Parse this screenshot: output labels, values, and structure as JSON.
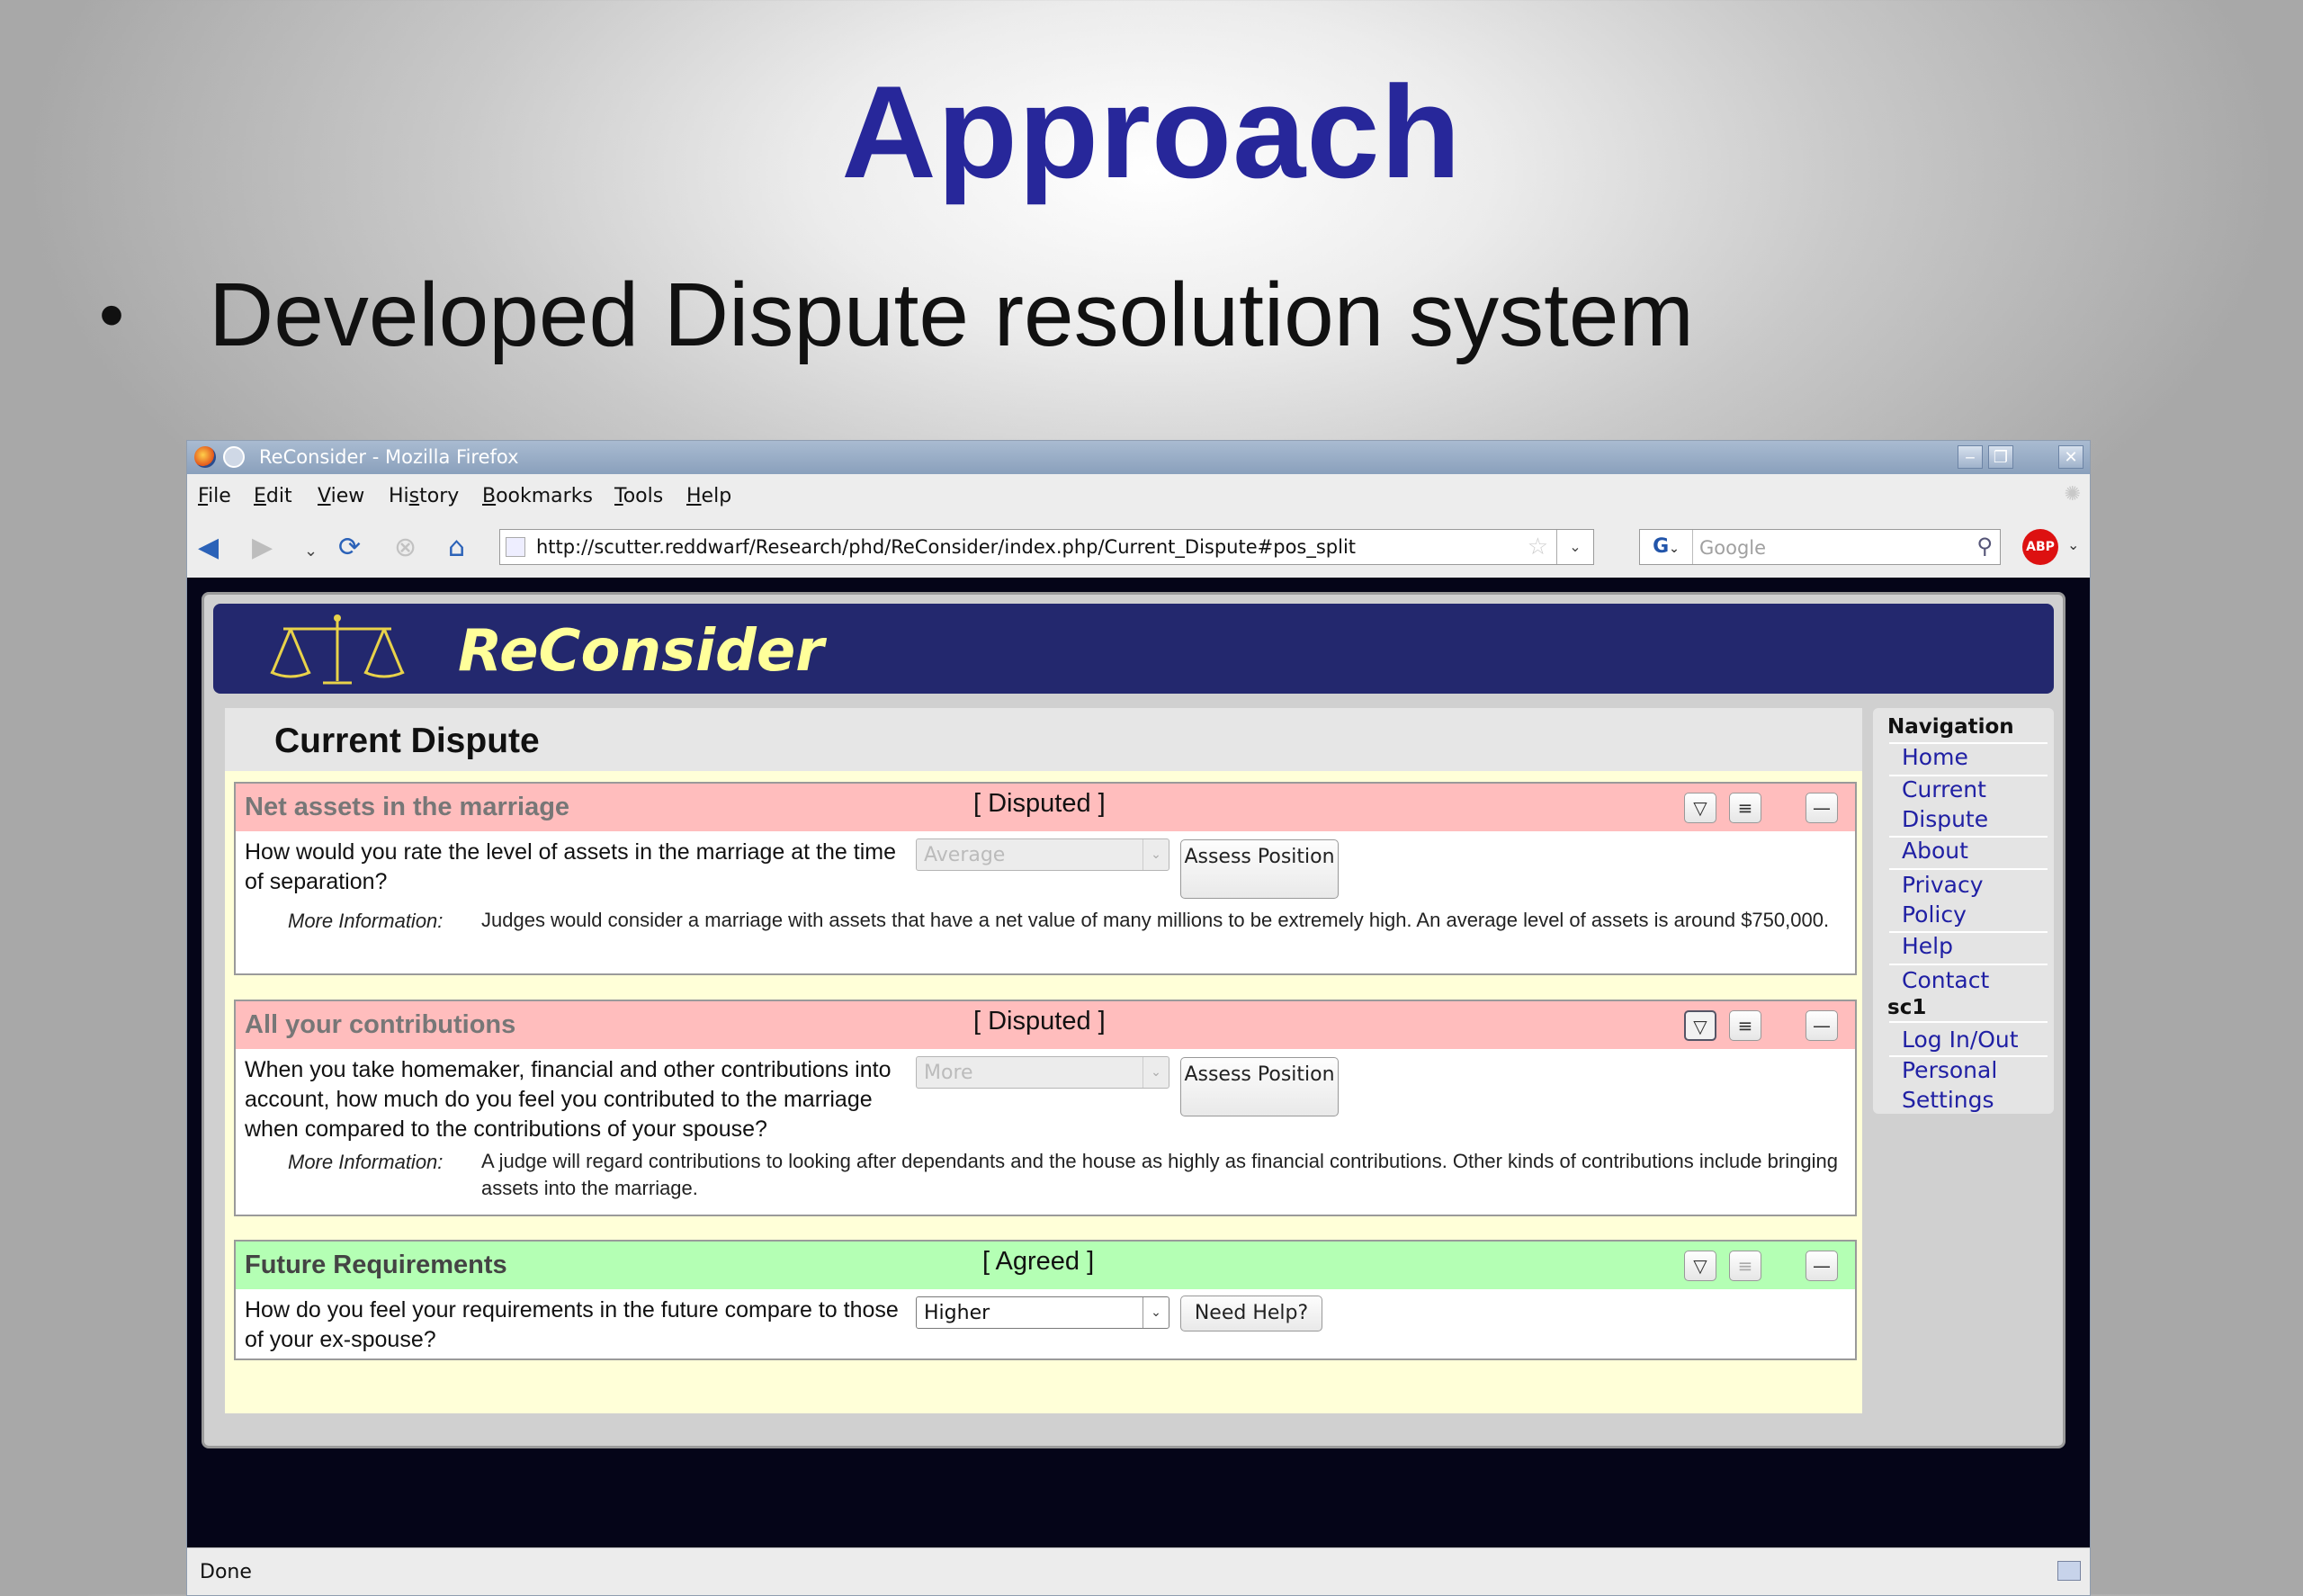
{
  "slide": {
    "title": "Approach",
    "bullet": "•",
    "bullet_text": "Developed Dispute resolution system"
  },
  "browser": {
    "window_title": "ReConsider - Mozilla Firefox",
    "menu": [
      "File",
      "Edit",
      "View",
      "History",
      "Bookmarks",
      "Tools",
      "Help"
    ],
    "menu_accel": [
      "F",
      "E",
      "V",
      "s",
      "B",
      "T",
      "H"
    ],
    "url": "http://scutter.reddwarf/Research/phd/ReConsider/index.php/Current_Dispute#pos_split",
    "search_placeholder": "Google",
    "search_engine": "G",
    "adblock": "ABP",
    "status": "Done"
  },
  "site": {
    "name": "ReConsider",
    "page_title": "Current Dispute",
    "nav_heading": "Navigation",
    "nav_links": [
      "Home",
      "Current Dispute",
      "About",
      "Privacy Policy",
      "Help",
      "Contact"
    ],
    "user_heading": "sc1",
    "user_links": [
      "Log In/Out",
      "Personal Settings"
    ]
  },
  "issues": [
    {
      "title": "Net assets in the marriage",
      "status": "[ Disputed ]",
      "question": "How would you rate the level of assets in the marriage at the time of separation?",
      "select_value": "Average",
      "button": "Assess Position",
      "more_info_label": "More Information:",
      "more_info": "Judges would consider a marriage with assets that have a net value of many millions to be extremely high. An average level of assets is around $750,000."
    },
    {
      "title": "All your contributions",
      "status": "[ Disputed ]",
      "question": "When you take homemaker, financial and other contributions into account, how much do you feel you contributed to the marriage when compared to the contributions of your spouse?",
      "select_value": "More",
      "button": "Assess Position",
      "more_info_label": "More Information:",
      "more_info": "A judge will regard contributions to looking after dependants and the house as highly as financial contributions. Other kinds of contributions include bringing assets into the marriage."
    },
    {
      "title": "Future Requirements",
      "status": "[ Agreed ]",
      "question": "How do you feel your requirements in the future compare to those of your ex-spouse?",
      "select_value": "Higher",
      "button": "Need Help?"
    }
  ],
  "colors": {
    "slide_title": "#27279a",
    "header_bg": "#23286e",
    "site_name": "#ffff9a",
    "disputed": "#ffbdbd",
    "agreed": "#b4ffb4",
    "link": "#2020a4"
  },
  "icons": {
    "back": "left-arrow-icon",
    "forward": "right-arrow-icon",
    "reload": "reload-icon",
    "stop": "stop-icon",
    "home": "home-icon",
    "bookmark": "star-icon",
    "search": "magnifier-icon",
    "logo": "scales-icon",
    "expand": "triangle-down-icon",
    "details": "list-icon",
    "collapse": "minus-icon"
  }
}
